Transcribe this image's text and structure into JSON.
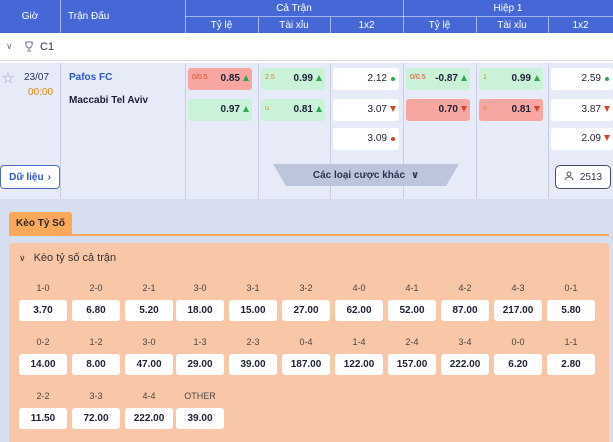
{
  "header": {
    "col_time": "Giờ",
    "col_match": "Trận Đấu",
    "group_full": "Cả Trận",
    "group_half": "Hiệp 1",
    "sub_handicap": "Tỷ lệ",
    "sub_overunder": "Tài xỉu",
    "sub_1x2": "1x2",
    "sub_handicap_h1": "Tỷ lệ",
    "sub_overunder_h1": "Tài xỉu",
    "sub_1x2_h1": "1x2"
  },
  "league": {
    "name": "C1",
    "icon": "trophy-icon"
  },
  "match": {
    "date": "23/07",
    "time": "00:00",
    "home": "Pafos FC",
    "away": "Maccabi Tel Aviv",
    "full_handicap": [
      {
        "head": "0/0.5",
        "value": "0.85",
        "trend": "up"
      },
      {
        "head": "",
        "value": "0.97",
        "trend": "up"
      }
    ],
    "full_overunder": [
      {
        "head": "2.5",
        "value": "0.99",
        "trend": "up"
      },
      {
        "head": "u",
        "value": "0.81",
        "trend": "up"
      }
    ],
    "full_1x2": [
      {
        "value": "2.12",
        "trend": "dot-green"
      },
      {
        "value": "3.07",
        "trend": "down"
      },
      {
        "value": "3.09",
        "trend": "dot-red"
      }
    ],
    "half_handicap": [
      {
        "head": "0/0.5",
        "value": "-0.87",
        "trend": "up"
      },
      {
        "head": "",
        "value": "0.70",
        "trend": "down"
      }
    ],
    "half_overunder": [
      {
        "head": "1",
        "value": "0.99",
        "trend": "up"
      },
      {
        "head": "u",
        "value": "0.81",
        "trend": "down"
      }
    ],
    "half_1x2": [
      {
        "value": "2.59",
        "trend": "dot-green"
      },
      {
        "value": "3.87",
        "trend": "down"
      },
      {
        "value": "2.09",
        "trend": "down"
      }
    ],
    "data_button": "Dữ liệu",
    "more_bets": "Các loại cược khác",
    "viewers": "2513"
  },
  "correct_score": {
    "tab": "Kèo Tỷ Số",
    "panel_title": "Kèo tỷ số cả trận",
    "rows": [
      [
        {
          "score": "1-0",
          "odd": "3.70"
        },
        {
          "score": "2-0",
          "odd": "6.80"
        },
        {
          "score": "2-1",
          "odd": "5.20"
        },
        {
          "score": "3-0",
          "odd": "18.00"
        },
        {
          "score": "3-1",
          "odd": "15.00"
        },
        {
          "score": "3-2",
          "odd": "27.00"
        },
        {
          "score": "4-0",
          "odd": "62.00"
        },
        {
          "score": "4-1",
          "odd": "52.00"
        },
        {
          "score": "4-2",
          "odd": "87.00"
        },
        {
          "score": "4-3",
          "odd": "217.00"
        },
        {
          "score": "0-1",
          "odd": "5.80"
        }
      ],
      [
        {
          "score": "0-2",
          "odd": "14.00"
        },
        {
          "score": "1-2",
          "odd": "8.00"
        },
        {
          "score": "3-0",
          "odd": "47.00"
        },
        {
          "score": "1-3",
          "odd": "29.00"
        },
        {
          "score": "2-3",
          "odd": "39.00"
        },
        {
          "score": "0-4",
          "odd": "187.00"
        },
        {
          "score": "1-4",
          "odd": "122.00"
        },
        {
          "score": "2-4",
          "odd": "157.00"
        },
        {
          "score": "3-4",
          "odd": "222.00"
        },
        {
          "score": "0-0",
          "odd": "6.20"
        },
        {
          "score": "1-1",
          "odd": "2.80"
        }
      ],
      [
        {
          "score": "2-2",
          "odd": "11.50"
        },
        {
          "score": "3-3",
          "odd": "72.00"
        },
        {
          "score": "4-4",
          "odd": "222.00"
        },
        {
          "score": "OTHER",
          "odd": "39.00"
        }
      ]
    ]
  }
}
